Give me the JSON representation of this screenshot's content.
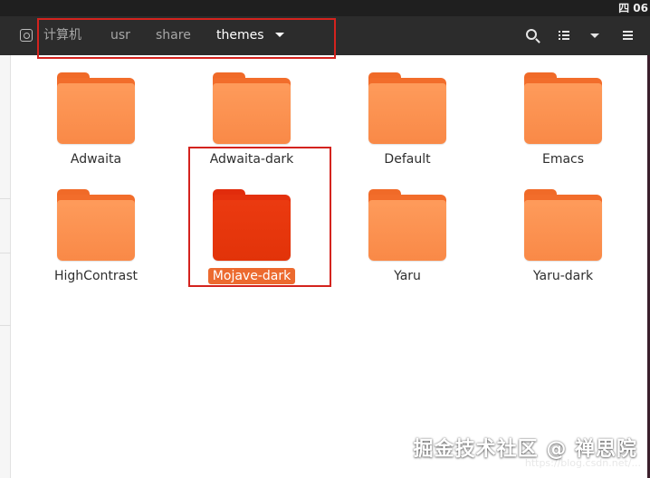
{
  "system_bar": {
    "clock_partial": "四 06"
  },
  "breadcrumb": {
    "items": [
      {
        "label": "计算机"
      },
      {
        "label": "usr"
      },
      {
        "label": "share"
      },
      {
        "label": "themes"
      }
    ],
    "active_index": 3
  },
  "toolbar": {
    "search_icon": "search-icon",
    "view_icon": "list-view-icon",
    "view_options_icon": "chevron-down-icon",
    "menu_icon": "hamburger-menu-icon"
  },
  "folders": [
    {
      "name": "Adwaita"
    },
    {
      "name": "Adwaita-dark"
    },
    {
      "name": "Default"
    },
    {
      "name": "Emacs"
    },
    {
      "name": "HighContrast"
    },
    {
      "name": "Mojave-dark",
      "selected": true
    },
    {
      "name": "Yaru"
    },
    {
      "name": "Yaru-dark"
    }
  ],
  "colors": {
    "header_bg": "#2c2c2c",
    "folder_orange": "#fe9b5b",
    "folder_selected": "#e23309",
    "selection_label_bg": "#ec6a2f",
    "annotation_red": "#d4231e"
  },
  "watermark": {
    "text": "掘金技术社区 @ 禅思院",
    "url_partial": "https://blog.csdn.net/..."
  }
}
